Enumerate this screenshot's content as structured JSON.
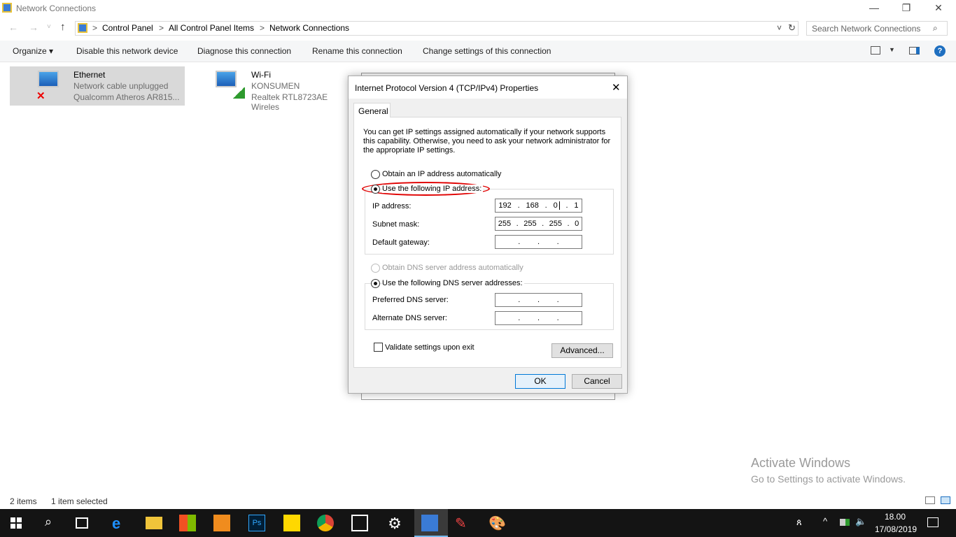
{
  "window": {
    "title": "Network Connections",
    "minimize": "—",
    "restore": "❐",
    "close": "✕"
  },
  "nav": {
    "back": "←",
    "forward": "→",
    "recent": "˅",
    "up": "↑",
    "breadcrumb": [
      "Control Panel",
      "All Control Panel Items",
      "Network Connections"
    ],
    "sep": ">",
    "refresh": "↻",
    "dropdown": "˅",
    "search_placeholder": "Search Network Connections"
  },
  "toolbar": {
    "organize": "Organize ▾",
    "disable": "Disable this network device",
    "diagnose": "Diagnose this connection",
    "rename": "Rename this connection",
    "change": "Change settings of this connection",
    "help": "?"
  },
  "items": [
    {
      "name": "Ethernet",
      "status": "Network cable unplugged",
      "adapter": "Qualcomm Atheros AR815..."
    },
    {
      "name": "Wi-Fi",
      "status": "KONSUMEN",
      "adapter": "Realtek RTL8723AE Wireles"
    }
  ],
  "status": {
    "count": "2 items",
    "selected": "1 item selected"
  },
  "dialog": {
    "title": "Internet Protocol Version 4 (TCP/IPv4) Properties",
    "close": "✕",
    "tab": "General",
    "intro": "You can get IP settings assigned automatically if your network supports this capability. Otherwise, you need to ask your network administrator for the appropriate IP settings.",
    "auto_ip": "Obtain an IP address automatically",
    "use_ip": "Use the following IP address:",
    "ip_label": "IP address:",
    "ip": [
      "192",
      "168",
      "0",
      "1"
    ],
    "mask_label": "Subnet mask:",
    "mask": [
      "255",
      "255",
      "255",
      "0"
    ],
    "gw_label": "Default gateway:",
    "dot": ".",
    "auto_dns": "Obtain DNS server address automatically",
    "use_dns": "Use the following DNS server addresses:",
    "pref_label": "Preferred DNS server:",
    "alt_label": "Alternate DNS server:",
    "validate": "Validate settings upon exit",
    "advanced": "Advanced...",
    "ok": "OK",
    "cancel": "Cancel"
  },
  "watermark": {
    "line1": "Activate Windows",
    "line2": "Go to Settings to activate Windows."
  },
  "clock": {
    "time": "18.00",
    "date": "17/08/2019"
  },
  "colors": {
    "highlight": "#e00000",
    "accent": "#0078d7"
  }
}
